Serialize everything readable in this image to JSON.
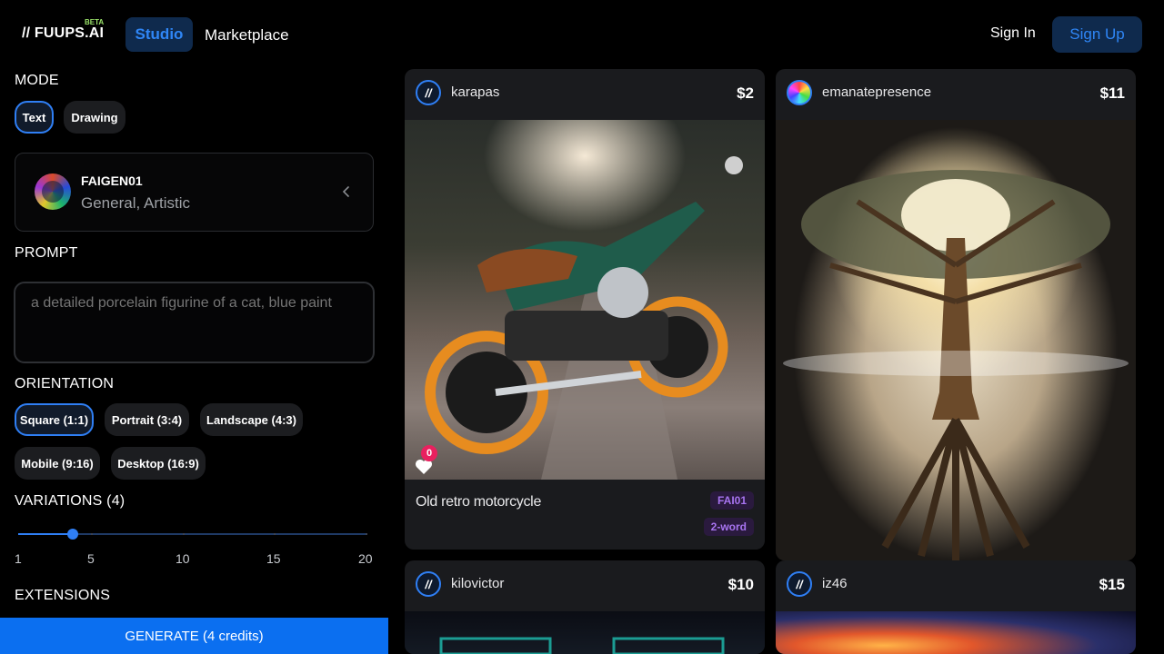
{
  "header": {
    "logo": "// FUUPS.AI",
    "beta": "BETA",
    "nav": {
      "studio": "Studio",
      "marketplace": "Marketplace"
    },
    "sign_in": "Sign In",
    "sign_up": "Sign Up"
  },
  "panel": {
    "mode": {
      "title": "MODE",
      "options": [
        "Text",
        "Drawing"
      ],
      "selected": "Text"
    },
    "model": {
      "name": "FAIGEN01",
      "tags": "General, Artistic"
    },
    "prompt": {
      "title": "PROMPT",
      "placeholder": "a detailed porcelain figurine of a cat, blue paint"
    },
    "orientation": {
      "title": "ORIENTATION",
      "options": [
        "Square (1:1)",
        "Portrait (3:4)",
        "Landscape (4:3)",
        "Mobile (9:16)",
        "Desktop (16:9)"
      ],
      "selected": "Square (1:1)"
    },
    "variations": {
      "title": "VARIATIONS (4)",
      "value": 4,
      "min": 1,
      "max": 20,
      "ticks": [
        "1",
        "5",
        "10",
        "15",
        "20"
      ]
    },
    "extensions": {
      "title": "EXTENSIONS"
    },
    "generate": "GENERATE (4 credits)"
  },
  "gallery": [
    {
      "user": "karapas",
      "price": "$2",
      "avatar": "//",
      "title": "Old retro motorcycle",
      "likes": "0",
      "badges": [
        "FAI01",
        "2-word"
      ]
    },
    {
      "user": "emanatepresence",
      "price": "$11"
    },
    {
      "user": "kilovictor",
      "price": "$10",
      "avatar": "//"
    },
    {
      "user": "iz46",
      "price": "$15",
      "avatar": "//"
    }
  ],
  "colors": {
    "accent": "#2f7ff5",
    "generate": "#0b6ff0",
    "like": "#e8215f",
    "badge_text": "#a774f0"
  }
}
